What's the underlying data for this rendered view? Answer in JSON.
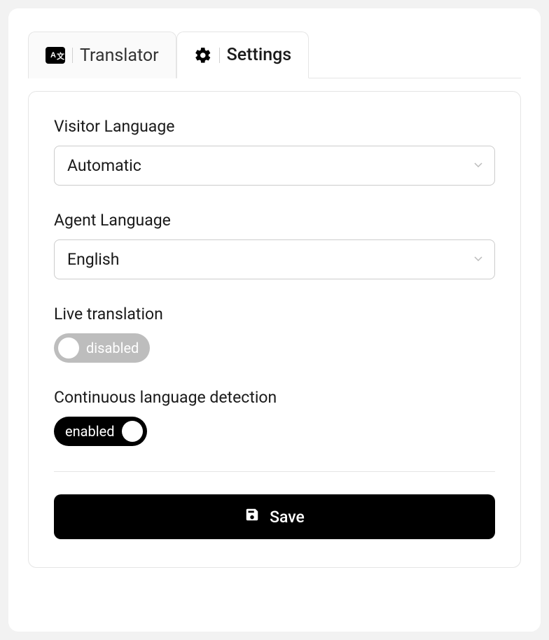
{
  "tabs": {
    "translator": {
      "label": "Translator"
    },
    "settings": {
      "label": "Settings"
    }
  },
  "settings": {
    "visitor_language": {
      "label": "Visitor Language",
      "value": "Automatic"
    },
    "agent_language": {
      "label": "Agent Language",
      "value": "English"
    },
    "live_translation": {
      "label": "Live translation",
      "state_label": "disabled"
    },
    "continuous_detection": {
      "label": "Continuous language detection",
      "state_label": "enabled"
    },
    "save_label": "Save"
  }
}
